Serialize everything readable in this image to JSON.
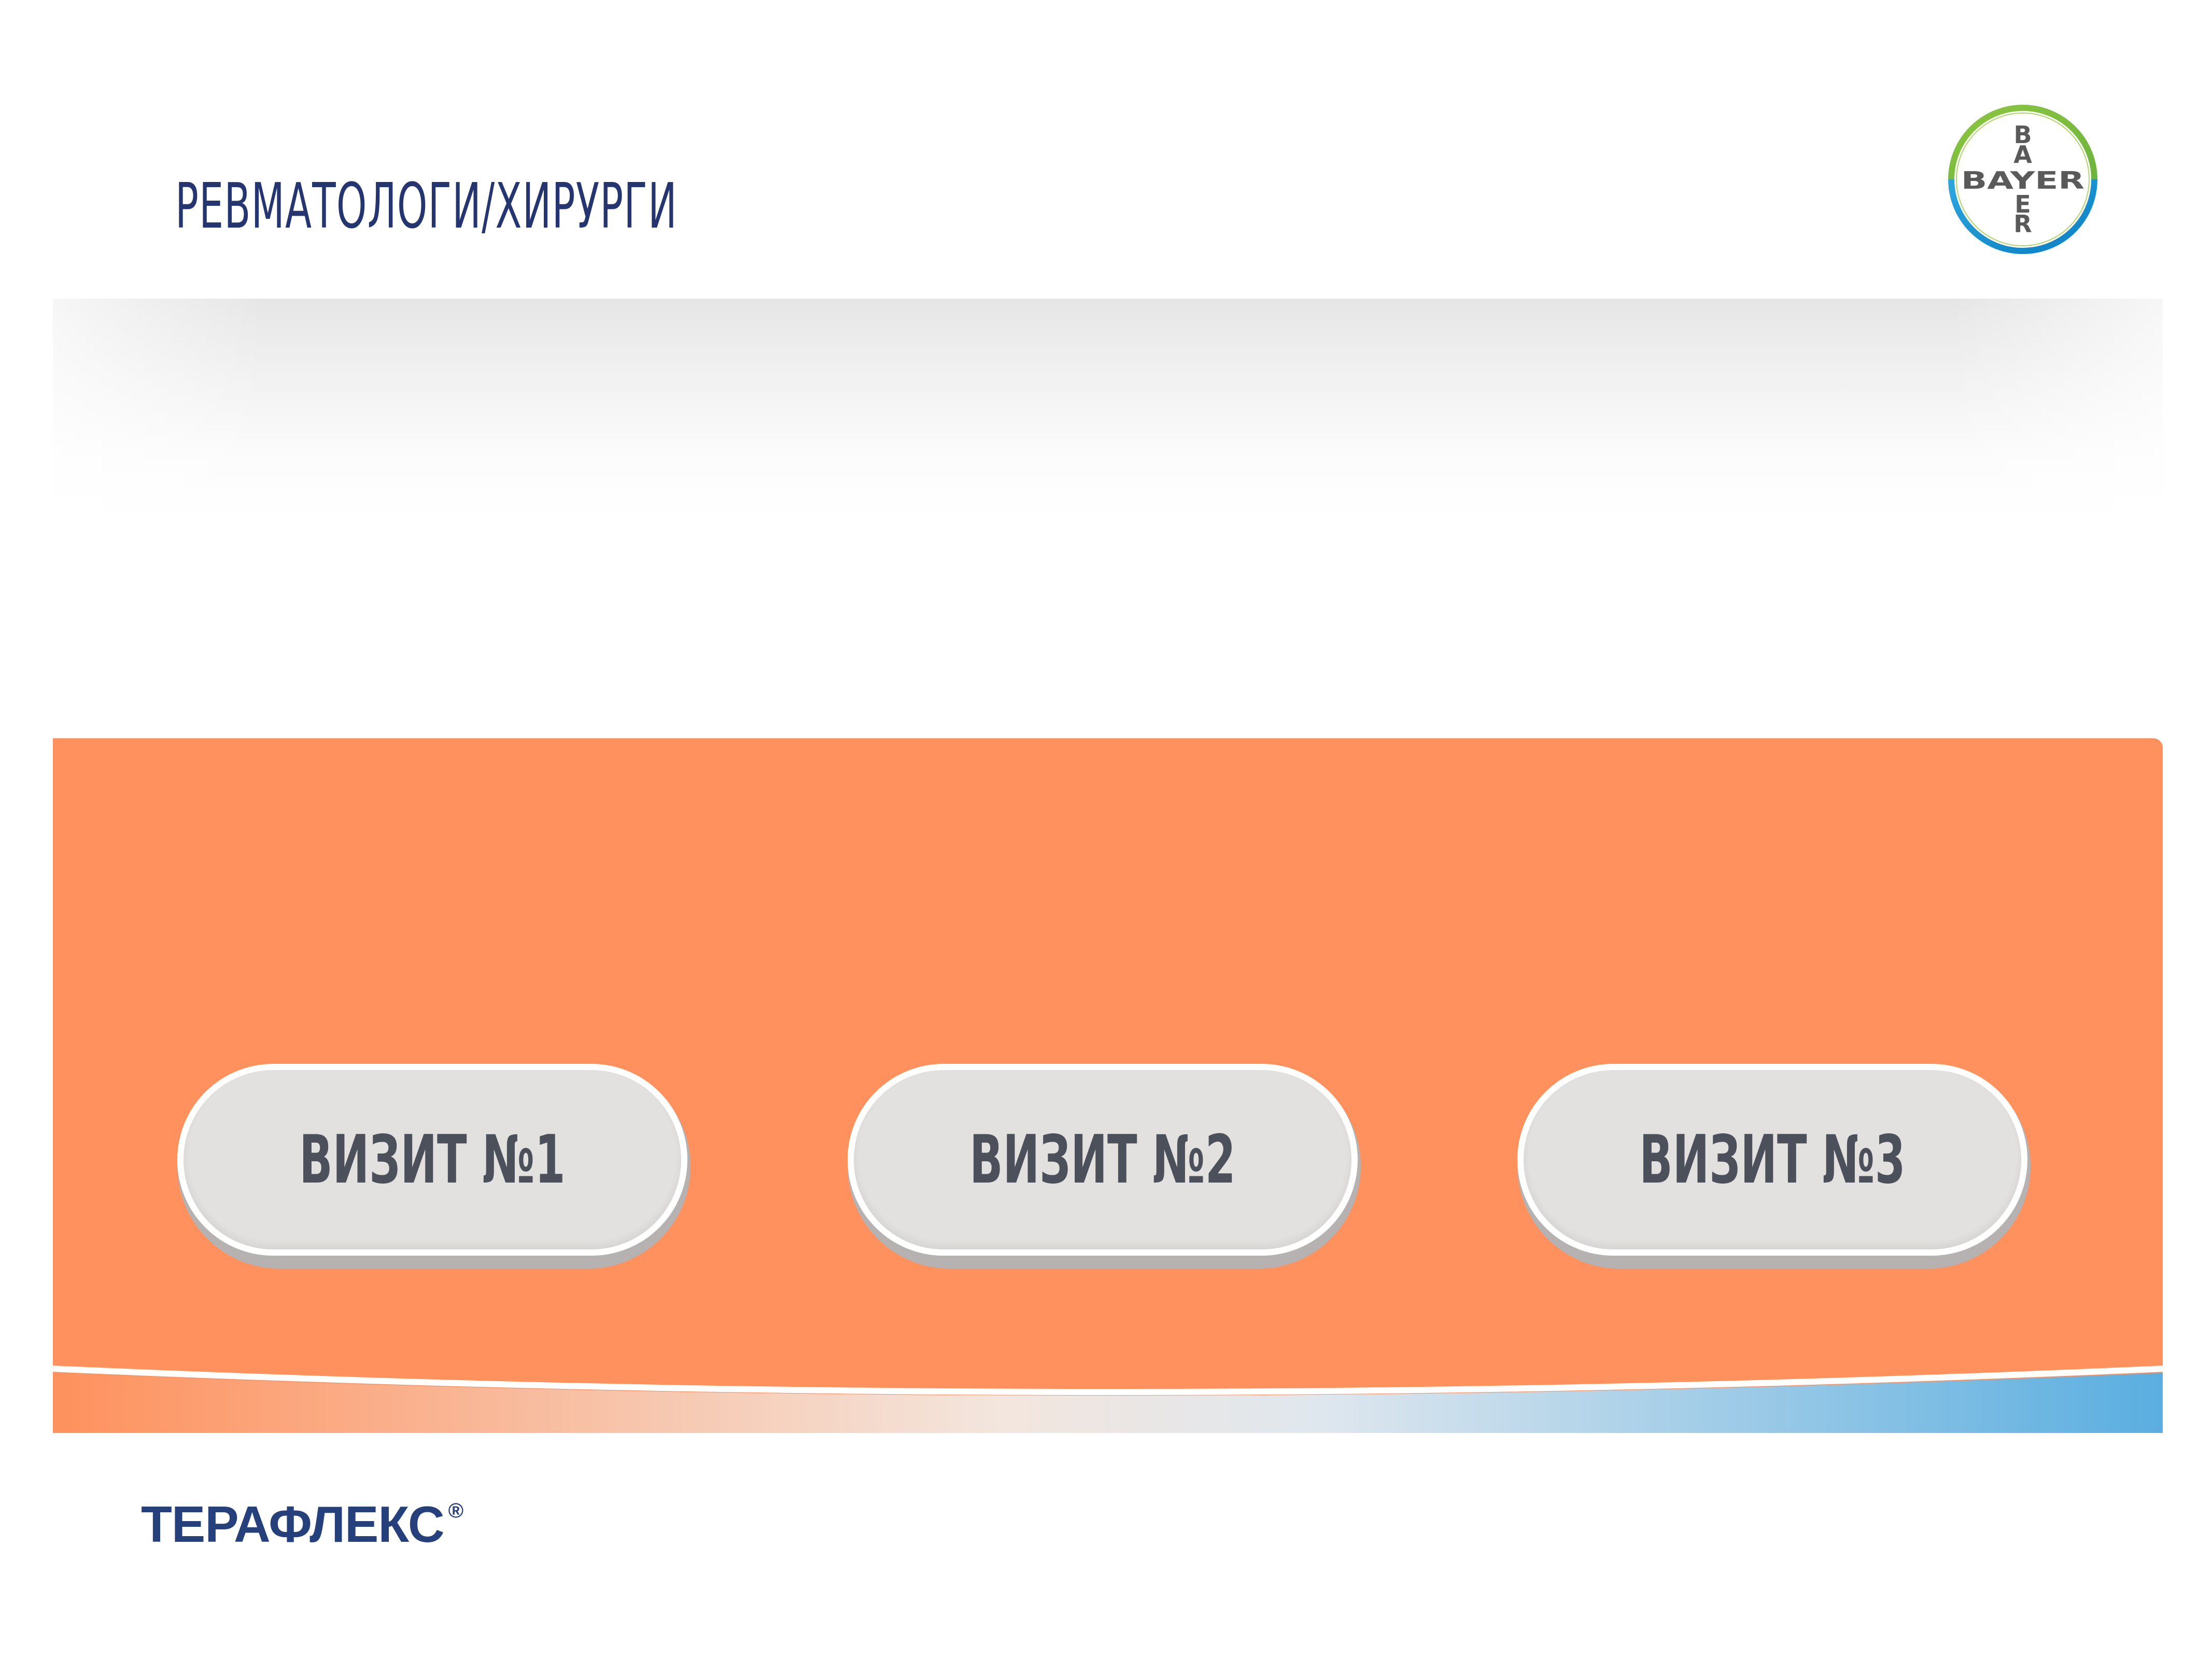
{
  "header": {
    "section_title": "РЕВМАТОЛОГИ/ХИРУРГИ",
    "logo": {
      "icon": "bayer-cross-icon",
      "horizontal_text": "BAYER",
      "vertical_letters": [
        "B",
        "A",
        "Y",
        "E",
        "R"
      ]
    }
  },
  "visits": [
    {
      "label": "ВИЗИТ №1"
    },
    {
      "label": "ВИЗИТ №2"
    },
    {
      "label": "ВИЗИТ №3"
    }
  ],
  "footer": {
    "brand_name": "ТЕРАФЛЕКС",
    "registered_mark": "®"
  },
  "colors": {
    "panel": "#fe915d",
    "title": "#25356f",
    "button_face": "#e3e0e0",
    "button_text": "#4c505b",
    "brand": "#25407a",
    "logo_green": "#89c442",
    "logo_blue": "#10a0dc"
  }
}
